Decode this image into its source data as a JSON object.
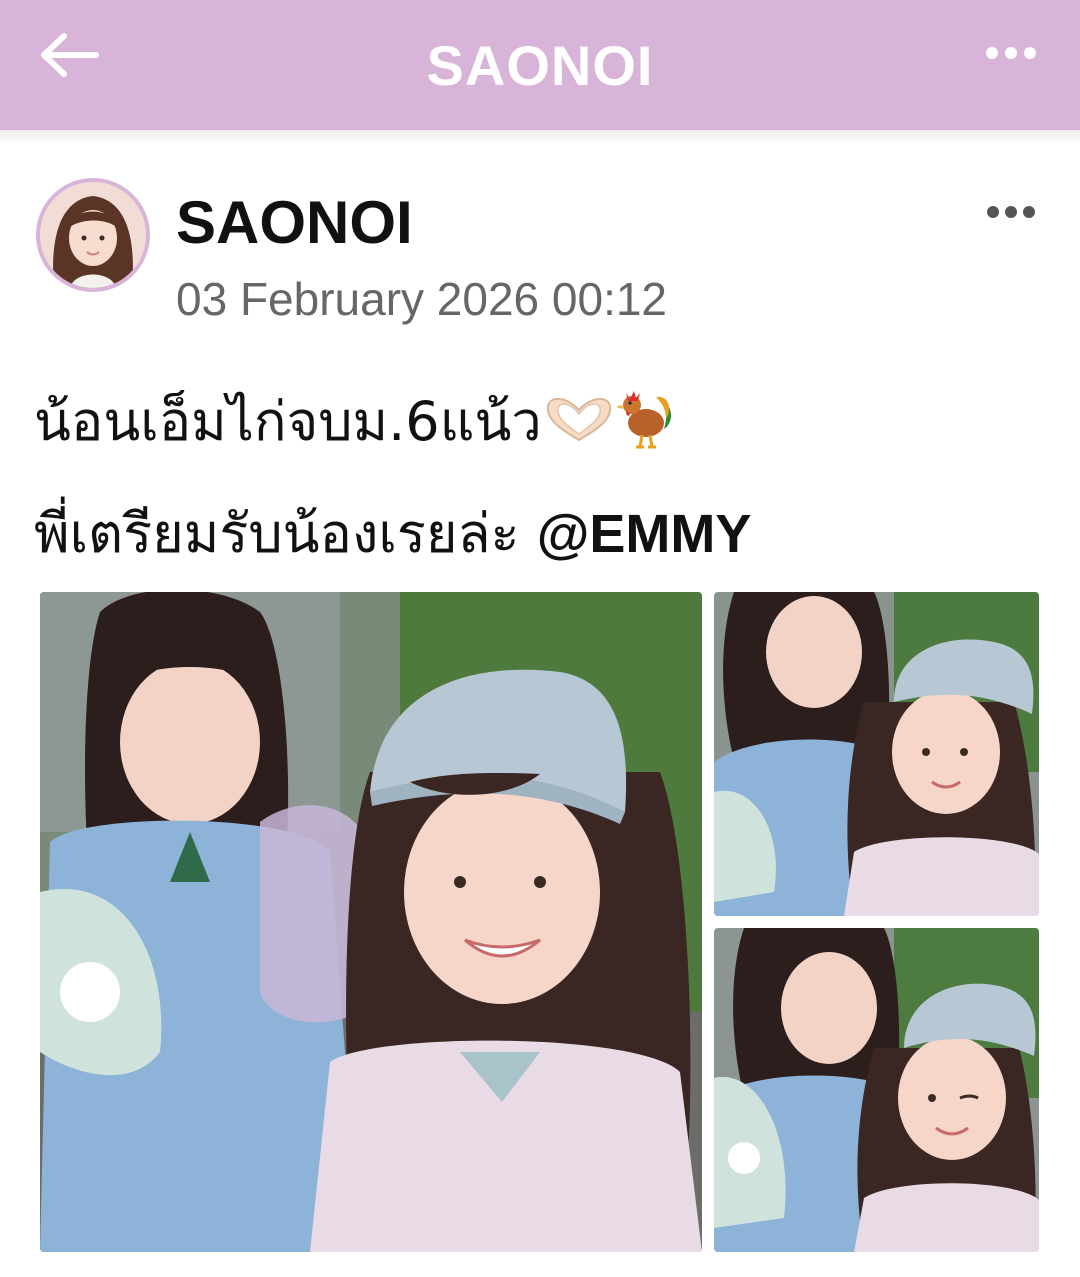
{
  "header": {
    "title": "SAONOI"
  },
  "post": {
    "author": "SAONOI",
    "timestamp": "03 February 2026 00:12",
    "caption_line1": "น้อนเอ็มไก่จบม.6แน้ว",
    "caption_line2_text": "พี่เตรียมรับน้องเรยล่ะ ",
    "mention": "@EMMY",
    "emojis": [
      "heart-hands-icon",
      "rooster-icon"
    ],
    "photos": [
      "photo-1",
      "photo-2",
      "photo-3"
    ]
  },
  "colors": {
    "accent": "#d8b4d9",
    "header_text": "#ffffff",
    "meta_text": "#666666"
  }
}
